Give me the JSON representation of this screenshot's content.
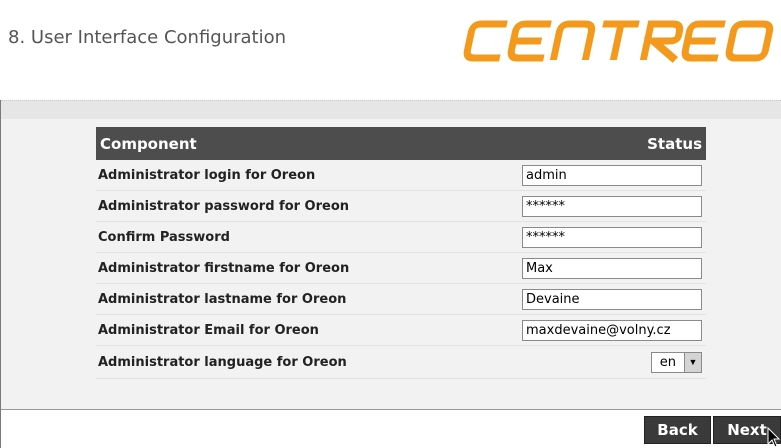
{
  "header": {
    "title": "8. User Interface Configuration",
    "logo_text": "CENTREON"
  },
  "table": {
    "col_component": "Component",
    "col_status": "Status",
    "rows": [
      {
        "label": "Administrator login for Oreon",
        "value": "admin"
      },
      {
        "label": "Administrator password for Oreon",
        "value": "******"
      },
      {
        "label": "Confirm Password",
        "value": "******"
      },
      {
        "label": "Administrator firstname for Oreon",
        "value": "Max"
      },
      {
        "label": "Administrator lastname for Oreon",
        "value": "Devaine"
      },
      {
        "label": "Administrator Email for Oreon",
        "value": "maxdevaine@volny.cz"
      }
    ],
    "language_row": {
      "label": "Administrator language for Oreon",
      "selected": "en"
    }
  },
  "footer": {
    "back_label": "Back",
    "next_label": "Next"
  },
  "colors": {
    "logo": "#f39a1c",
    "table_header": "#4d4d4d",
    "button": "#3a3a3a"
  }
}
